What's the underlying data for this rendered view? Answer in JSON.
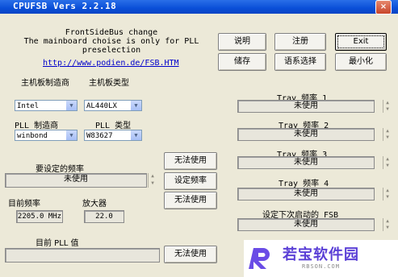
{
  "window": {
    "title": "CPUFSB  Vers 2.2.18",
    "close_glyph": "×"
  },
  "header": {
    "line1": "FrontSideBus change",
    "line2": "The mainboard choise is only for PLL",
    "line3": "preselection",
    "url": "http://www.podien.de/FSB.HTM"
  },
  "buttons": {
    "explain": "说明",
    "register": "注册",
    "exit": "Exit",
    "save": "储存",
    "language": "语系选择",
    "minimize": "最小化",
    "unavailable1": "无法使用",
    "set_freq": "设定频率",
    "unavailable2": "无法使用",
    "unavailable3": "无法使用"
  },
  "mainboard": {
    "maker_label": "主机板制造商",
    "type_label": "主机板类型",
    "maker_value": "Intel",
    "type_value": "AL440LX"
  },
  "pll": {
    "maker_label": "PLL 制造商",
    "type_label": "PLL 类型",
    "maker_value": "winbond",
    "type_value": "W83627"
  },
  "target": {
    "label": "要设定的频率",
    "value": "未使用"
  },
  "current": {
    "freq_label": "目前频率",
    "multiplier_label": "放大器",
    "freq_value": "2205.0 MHz",
    "multiplier_value": "22.0"
  },
  "pll_value": {
    "label": "目前 PLL 值",
    "value": ""
  },
  "tray": [
    {
      "label": "Tray 频率 1",
      "value": "未使用"
    },
    {
      "label": "Tray 频率 2",
      "value": "未使用"
    },
    {
      "label": "Tray 频率 3",
      "value": "未使用"
    },
    {
      "label": "Tray 频率 4",
      "value": "未使用"
    }
  ],
  "next_start": {
    "label": "设定下次启动的 FSB",
    "value": "未使用"
  },
  "watermark": {
    "main": "若宝软件园",
    "sub": "RBSON.COM"
  },
  "colors": {
    "titlebar": "#0a4fd8",
    "background": "#ece9d8",
    "link": "#0000cc",
    "watermark": "#5a3fd6"
  }
}
